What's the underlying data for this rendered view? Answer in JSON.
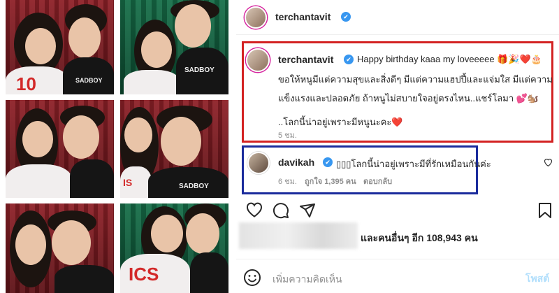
{
  "post": {
    "author": "terchantavit",
    "verified_mark": "✔"
  },
  "caption": {
    "author": "terchantavit",
    "line1": "Happy birthday kaaa my loveeeee 🎁🎉❤️🎂",
    "line2": "ขอให้หนูมีแต่ความสุขและสิ่งดีๆ มีแต่ความแฮปปี้และแจ่มใส มีแต่ความ",
    "line3": "แข็งแรงและปลอดภัย ถ้าหนูไม่สบายใจอยู่ตรงไหน..แชร์โลมา 💕🐿️",
    "line4": "..โลกนี้น่าอยู่เพราะมีหนูนะคะ❤️",
    "time": "5 ชม."
  },
  "reply": {
    "author": "davikah",
    "text": "▯▯▯โลกนี้น่าอยู่เพราะมีที่รักเหมือนกันค่ะ",
    "time": "6 ชม.",
    "likes": "ถูกใจ 1,395 คน",
    "reply_label": "ตอบกลับ"
  },
  "likes": {
    "text": "และคนอื่นๆ อีก 108,943 คน"
  },
  "comment": {
    "placeholder": "เพิ่มความคิดเห็น",
    "post_label": "โพสต์"
  },
  "icons": {
    "like": "heart-outline-icon",
    "comment": "comment-bubble-icon",
    "share": "paper-plane-icon",
    "save": "bookmark-icon",
    "emoji": "smiley-icon",
    "reply_like": "heart-small-icon"
  },
  "colors": {
    "caption_box": "#d32222",
    "reply_box": "#1a2b9c",
    "verified": "#3897f0",
    "post_button": "#b2dffc"
  }
}
